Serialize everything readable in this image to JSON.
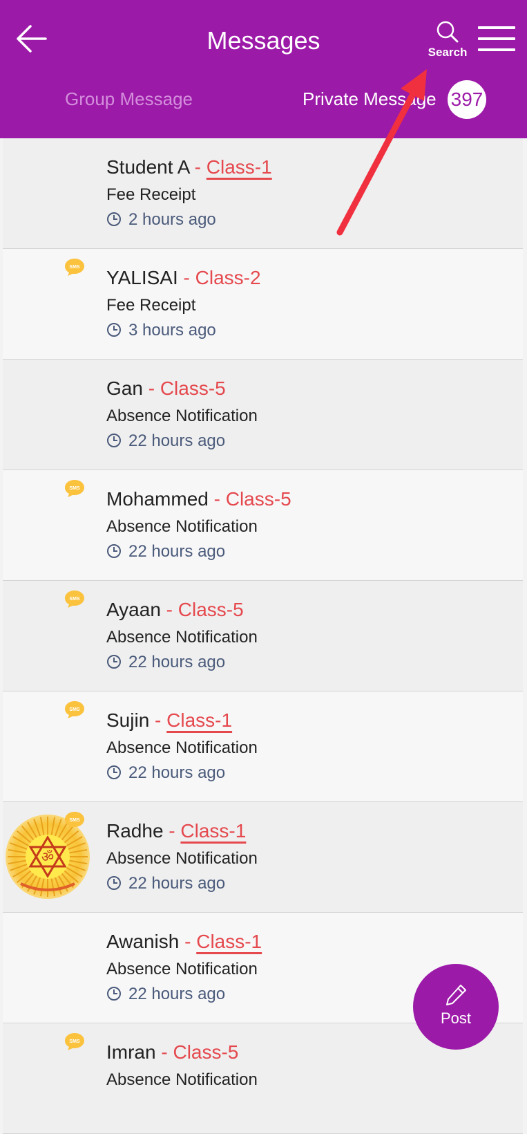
{
  "header": {
    "title": "Messages",
    "search_label": "Search",
    "tabs": [
      {
        "label": "Group Message",
        "active": false
      },
      {
        "label": "Private Message",
        "active": true,
        "badge": "397"
      }
    ]
  },
  "messages": [
    {
      "name": "Student A",
      "separator": " - ",
      "class": "Class-1",
      "subject": "Fee Receipt",
      "time": "2 hours ago",
      "sms": false,
      "avatar": false,
      "underlined": true
    },
    {
      "name": "YALISAI",
      "separator": " - ",
      "class": "Class-2",
      "subject": "Fee Receipt",
      "time": "3 hours ago",
      "sms": true,
      "avatar": false,
      "underlined": false
    },
    {
      "name": "Gan",
      "separator": " - ",
      "class": "Class-5",
      "subject": "Absence Notification",
      "time": "22 hours ago",
      "sms": false,
      "avatar": false,
      "underlined": false
    },
    {
      "name": "Mohammed",
      "separator": " - ",
      "class": "Class-5",
      "subject": "Absence Notification",
      "time": "22 hours ago",
      "sms": true,
      "avatar": false,
      "underlined": false
    },
    {
      "name": "Ayaan",
      "separator": " - ",
      "class": "Class-5",
      "subject": "Absence Notification",
      "time": "22 hours ago",
      "sms": true,
      "avatar": false,
      "underlined": false
    },
    {
      "name": "Sujin",
      "separator": " - ",
      "class": "Class-1",
      "subject": "Absence Notification",
      "time": "22 hours ago",
      "sms": true,
      "avatar": false,
      "underlined": true
    },
    {
      "name": "Radhe",
      "separator": " - ",
      "class": "Class-1",
      "subject": "Absence Notification",
      "time": "22 hours ago",
      "sms": true,
      "avatar": true,
      "underlined": true
    },
    {
      "name": "Awanish",
      "separator": " - ",
      "class": "Class-1",
      "subject": "Absence Notification",
      "time": "22 hours ago",
      "sms": false,
      "avatar": false,
      "underlined": true
    },
    {
      "name": "Imran",
      "separator": " - ",
      "class": "Class-5",
      "subject": "Absence Notification",
      "time": "",
      "sms": true,
      "avatar": false,
      "underlined": false
    }
  ],
  "fab": {
    "label": "Post"
  },
  "colors": {
    "primary": "#9c1aa8",
    "class_link": "#e5484d",
    "annotation_arrow": "#f0303f",
    "sms_badge": "#fbc23e"
  }
}
